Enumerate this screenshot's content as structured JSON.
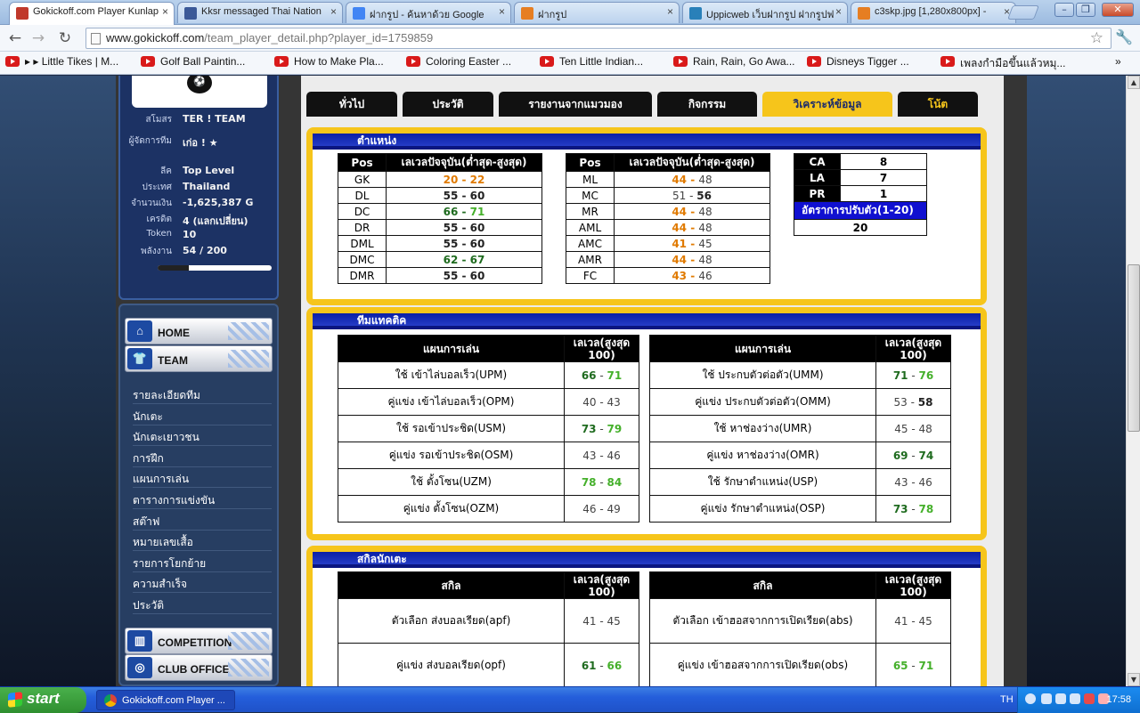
{
  "browser": {
    "tabs": [
      {
        "title": "Gokickoff.com Player Kunlap",
        "fav": "ball-icon",
        "color": "#c0392b",
        "active": true
      },
      {
        "title": "Kksr messaged Thai Nation",
        "fav": "facebook-icon",
        "color": "#3b5998"
      },
      {
        "title": "ฝากรูป - ค้นหาด้วย Google",
        "fav": "google-icon",
        "color": "#4285f4"
      },
      {
        "title": "ฝากรูป",
        "fav": "image-host-icon",
        "color": "#e67e22"
      },
      {
        "title": "Uppicweb เว็บฝากรูป ฝากรูปฟ",
        "fav": "loading-icon",
        "color": "#2980b9"
      },
      {
        "title": "c3skp.jpg [1,280x800px] -",
        "fav": "image-host-icon",
        "color": "#e67e22"
      }
    ],
    "url_host": "www.gokickoff.com",
    "url_path": "/team_player_detail.php?player_id=1759859",
    "bookmarks": [
      "▸ ▸ Little Tikes | M...",
      "Golf Ball Paintin...",
      "How to Make Pla...",
      "Coloring Easter ...",
      "Ten Little Indian...",
      "Rain, Rain, Go Awa...",
      "Disneys Tigger ...",
      "เพลงกำมือขึ้นแล้วหมุ..."
    ]
  },
  "profile": {
    "rows": [
      {
        "k": "สโมสร",
        "v": "TER ! TEAM"
      },
      {
        "k": "ผู้จัดการทีม",
        "v": "เก่อ ! ★"
      },
      {
        "k": "ลีค",
        "v": "Top Level"
      },
      {
        "k": "ประเทศ",
        "v": "Thailand"
      },
      {
        "k": "จำนวนเงิน",
        "v": "-1,625,387 G"
      },
      {
        "k": "เครดิต",
        "v": "4 (แลกเปลี่ยน)"
      },
      {
        "k": "Token",
        "v": "10"
      },
      {
        "k": "พลังงาน",
        "v": "54 / 200"
      }
    ],
    "energy_fraction": 0.27
  },
  "menu": {
    "home": "HOME",
    "team": "TEAM",
    "subitems": [
      "รายละเอียดทีม",
      "นักเตะ",
      "นักเตะเยาวชน",
      "การฝึก",
      "แผนการเล่น",
      "ตารางการแข่งขัน",
      "สต๊าฟ",
      "หมายเลขเสื้อ",
      "รายการโยกย้าย",
      "ความสำเร็จ",
      "ประวัติ"
    ],
    "competition": "COMPETITION",
    "club_office": "CLUB OFFICE"
  },
  "content_tabs": [
    "ทั่วไป",
    "ประวัติ",
    "รายงานจากแมวมอง",
    "กิจกรรม",
    "วิเคราะห์ข้อมูล",
    "โน้ต"
  ],
  "positions": {
    "title": "ตำแหน่ง",
    "header_pos": "Pos",
    "header_level": "เลเวลปัจจุบัน(ต่ำสุด-สูงสุด)",
    "left": [
      {
        "pos": "GK",
        "min": "20",
        "max": "22",
        "c1": "co",
        "c2": "co"
      },
      {
        "pos": "DL",
        "min": "55",
        "max": "60",
        "c1": "cd",
        "c2": "cd"
      },
      {
        "pos": "DC",
        "min": "66",
        "max": "71",
        "c1": "cg",
        "c2": "cgl"
      },
      {
        "pos": "DR",
        "min": "55",
        "max": "60",
        "c1": "cd",
        "c2": "cd"
      },
      {
        "pos": "DML",
        "min": "55",
        "max": "60",
        "c1": "cd",
        "c2": "cd"
      },
      {
        "pos": "DMC",
        "min": "62",
        "max": "67",
        "c1": "cg",
        "c2": "cg"
      },
      {
        "pos": "DMR",
        "min": "55",
        "max": "60",
        "c1": "cd",
        "c2": "cd"
      }
    ],
    "right": [
      {
        "pos": "ML",
        "min": "44",
        "max": "48",
        "c1": "co",
        "c2": "cs"
      },
      {
        "pos": "MC",
        "min": "51",
        "max": "56",
        "c1": "cs",
        "c2": "cd"
      },
      {
        "pos": "MR",
        "min": "44",
        "max": "48",
        "c1": "co",
        "c2": "cs"
      },
      {
        "pos": "AML",
        "min": "44",
        "max": "48",
        "c1": "co",
        "c2": "cs"
      },
      {
        "pos": "AMC",
        "min": "41",
        "max": "45",
        "c1": "co",
        "c2": "cs"
      },
      {
        "pos": "AMR",
        "min": "44",
        "max": "48",
        "c1": "co",
        "c2": "cs"
      },
      {
        "pos": "FC",
        "min": "43",
        "max": "46",
        "c1": "co",
        "c2": "cs"
      }
    ],
    "ratings": [
      {
        "k": "CA",
        "v": "8"
      },
      {
        "k": "LA",
        "v": "7"
      },
      {
        "k": "PR",
        "v": "1"
      }
    ],
    "adapt_label": "อัตราการปรับตัว(1-20)",
    "adapt_value": "20"
  },
  "tactics": {
    "title": "ทีมแทคติค",
    "header_name": "แผนการเล่น",
    "header_level": "เลเวล(สูงสุด 100)",
    "left": [
      {
        "name": "ใช้ เข้าไล่บอลเร็ว(UPM)",
        "min": "66",
        "max": "71",
        "c1": "cg",
        "c2": "cgl"
      },
      {
        "name": "คู่แข่ง เข้าไล่บอลเร็ว(OPM)",
        "min": "40",
        "max": "43",
        "c1": "cs",
        "c2": "cs"
      },
      {
        "name": "ใช้ รอเข้าประชิด(USM)",
        "min": "73",
        "max": "79",
        "c1": "cg",
        "c2": "cgl"
      },
      {
        "name": "คู่แข่ง รอเข้าประชิด(OSM)",
        "min": "43",
        "max": "46",
        "c1": "cs",
        "c2": "cs"
      },
      {
        "name": "ใช้ ตั้งโซน(UZM)",
        "min": "78",
        "max": "84",
        "c1": "cgl",
        "c2": "cgl"
      },
      {
        "name": "คู่แข่ง ตั้งโซน(OZM)",
        "min": "46",
        "max": "49",
        "c1": "cs",
        "c2": "cs"
      }
    ],
    "right": [
      {
        "name": "ใช้ ประกบตัวต่อตัว(UMM)",
        "min": "71",
        "max": "76",
        "c1": "cg",
        "c2": "cgl"
      },
      {
        "name": "คู่แข่ง ประกบตัวต่อตัว(OMM)",
        "min": "53",
        "max": "58",
        "c1": "cs",
        "c2": "cd"
      },
      {
        "name": "ใช้ หาช่องว่าง(UMR)",
        "min": "45",
        "max": "48",
        "c1": "cs",
        "c2": "cs"
      },
      {
        "name": "คู่แข่ง หาช่องว่าง(OMR)",
        "min": "69",
        "max": "74",
        "c1": "cg",
        "c2": "cg"
      },
      {
        "name": "ใช้ รักษาตำแหน่ง(USP)",
        "min": "43",
        "max": "46",
        "c1": "cs",
        "c2": "cs"
      },
      {
        "name": "คู่แข่ง รักษาตำแหน่ง(OSP)",
        "min": "73",
        "max": "78",
        "c1": "cg",
        "c2": "cgl"
      }
    ]
  },
  "skills": {
    "title": "สกิลนักเตะ",
    "header_name": "สกิล",
    "header_level": "เลเวล(สูงสุด 100)",
    "left": [
      {
        "name": "ตัวเลือก ส่งบอลเรียด(apf)",
        "min": "41",
        "max": "45",
        "c1": "cs",
        "c2": "cs"
      },
      {
        "name": "คู่แข่ง ส่งบอลเรียด(opf)",
        "min": "61",
        "max": "66",
        "c1": "cg",
        "c2": "cgl"
      }
    ],
    "right": [
      {
        "name": "ตัวเลือก เข้าฮอสจากการเปิดเรียด(abs)",
        "min": "41",
        "max": "45",
        "c1": "cs",
        "c2": "cs"
      },
      {
        "name": "คู่แข่ง เข้าฮอสจากการเปิดเรียด(obs)",
        "min": "65",
        "max": "71",
        "c1": "cgl",
        "c2": "cgl"
      }
    ]
  },
  "taskbar": {
    "start": "start",
    "task": "Gokickoff.com Player ...",
    "lang": "TH",
    "clock": "17:58"
  }
}
